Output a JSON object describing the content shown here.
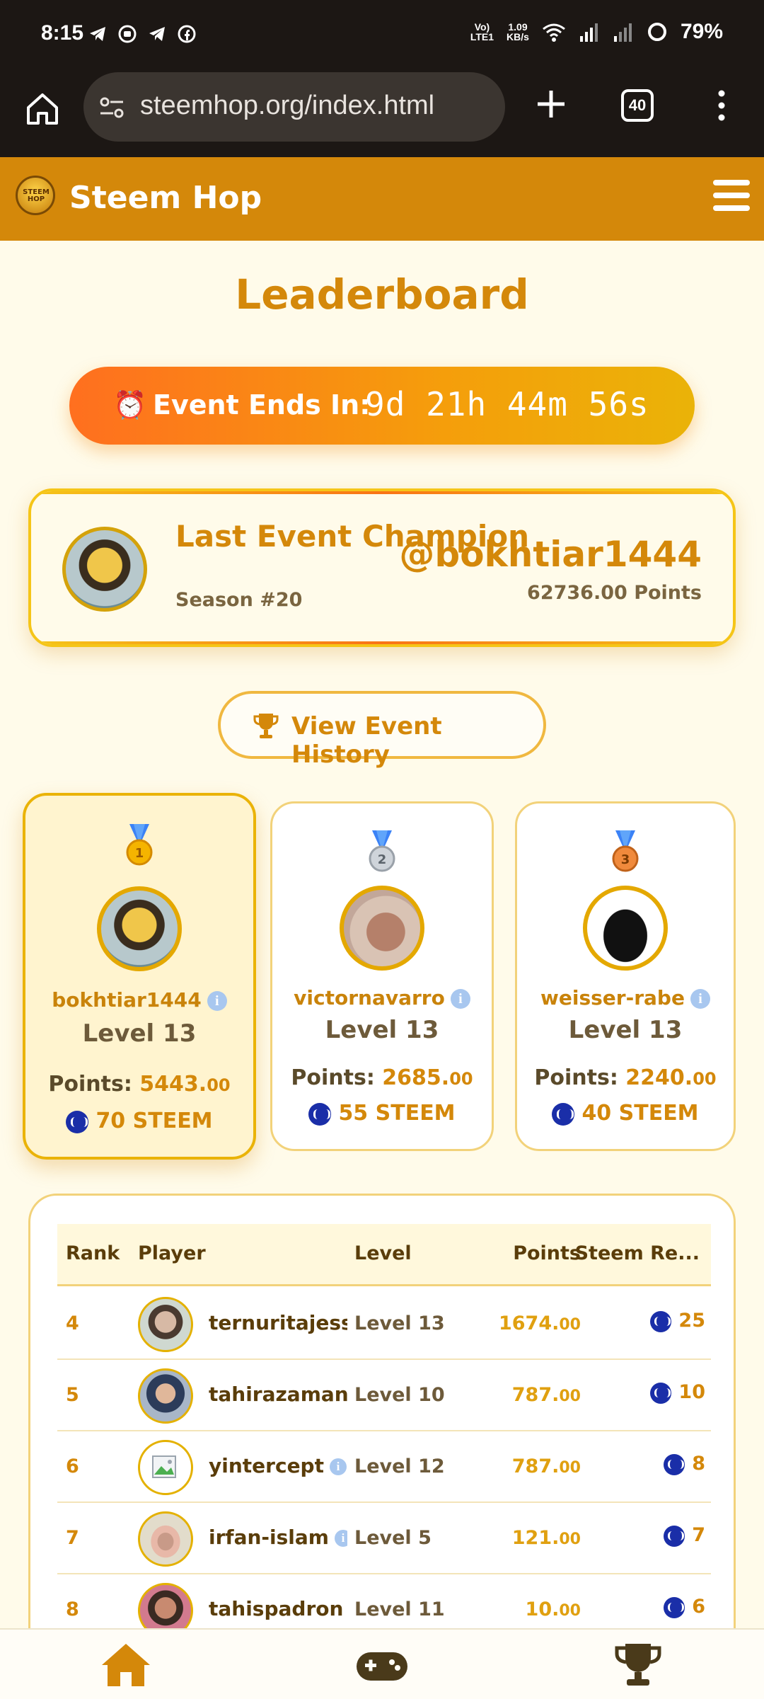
{
  "status_bar": {
    "time": "8:15",
    "network_label_top": "Vo)",
    "network_label_bottom": "LTE1",
    "speed_top": "1.09",
    "speed_bottom": "KB/s",
    "battery": "79%"
  },
  "browser": {
    "url": "steemhop.org/index.html",
    "tab_count": "40"
  },
  "site": {
    "title": "Steem Hop",
    "logo_text": "STEEM HOP"
  },
  "leaderboard": {
    "title": "Leaderboard"
  },
  "timer": {
    "icon": "⏰",
    "label": "Event Ends In:",
    "value": "9d 21h 44m 56s"
  },
  "champion": {
    "title": "Last Event Champion",
    "season": "Season #20",
    "username": "@bokhtiar1444",
    "points": "62736.00 Points"
  },
  "history_button": {
    "label": "View Event History"
  },
  "podium": [
    {
      "medal_number": "1",
      "name": "bokhtiar1444",
      "level": "Level 13",
      "points_label": "Points:",
      "points_int": "5443.",
      "points_dec": "00",
      "reward": "70 STEEM"
    },
    {
      "medal_number": "2",
      "name": "victornavarro",
      "level": "Level 13",
      "points_label": "Points:",
      "points_int": "2685.",
      "points_dec": "00",
      "reward": "55 STEEM"
    },
    {
      "medal_number": "3",
      "name": "weisser-rabe",
      "level": "Level 13",
      "points_label": "Points:",
      "points_int": "2240.",
      "points_dec": "00",
      "reward": "40 STEEM"
    }
  ],
  "table": {
    "headers": {
      "rank": "Rank",
      "player": "Player",
      "level": "Level",
      "points": "Points",
      "reward": "Steem Re..."
    },
    "rows": [
      {
        "rank": "4",
        "name": "ternuritajessi",
        "level": "Level 13",
        "points_int": "1674.",
        "points_dec": "00",
        "reward": "25"
      },
      {
        "rank": "5",
        "name": "tahirazaman",
        "level": "Level 10",
        "points_int": "787.",
        "points_dec": "00",
        "reward": "10"
      },
      {
        "rank": "6",
        "name": "yintercept",
        "level": "Level 12",
        "points_int": "787.",
        "points_dec": "00",
        "reward": "8"
      },
      {
        "rank": "7",
        "name": "irfan-islam",
        "level": "Level 5",
        "points_int": "121.",
        "points_dec": "00",
        "reward": "7"
      },
      {
        "rank": "8",
        "name": "tahispadron",
        "level": "Level 11",
        "points_int": "10.",
        "points_dec": "00",
        "reward": "6"
      }
    ]
  },
  "colors": {
    "brand_orange": "#d4880a",
    "brand_gold": "#eab308",
    "steem_blue": "#1a2ea8",
    "background": "#fffbea"
  }
}
